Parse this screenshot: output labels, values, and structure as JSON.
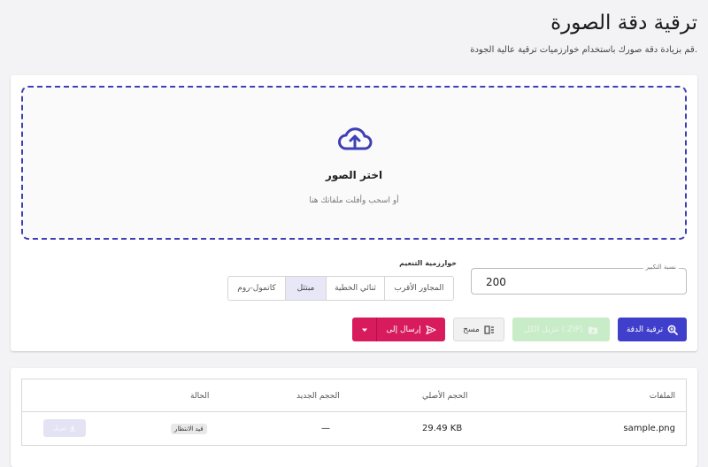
{
  "header": {
    "title": "ترقية دقة الصورة",
    "subtitle": "قم بزيادة دقة صورك باستخدام خوارزميات ترقية عالية الجودة."
  },
  "dropzone": {
    "icon": "cloud-upload-icon",
    "title": "اختر الصور",
    "subtitle": "أو اسحب وأفلت ملفاتك هنا"
  },
  "scale_field": {
    "label": "نسبة التكبير",
    "value": "200"
  },
  "algorithm": {
    "label": "خوارزمية التنعيم",
    "options": [
      "المجاور الأقرب",
      "ثنائي الخطية",
      "مبتثل",
      "كاتمول-روم"
    ],
    "selected": "مبتثل"
  },
  "actions": {
    "upscale_label": "ترقية الدقة",
    "zip_label": "تنزيل الكل (.ZIP)",
    "clear_label": "مسح",
    "send_label": "إرسال إلى"
  },
  "colors": {
    "primary": "#3f3fcc",
    "send": "#d81b5c",
    "zip_disabled": "#c8ecc8"
  },
  "table": {
    "headers": {
      "file": "الملفات",
      "original_size": "الحجم الأصلي",
      "new_size": "الحجم الجديد",
      "status": "الحالة"
    },
    "rows": [
      {
        "file": "sample.png",
        "original_size": "29.49 KB",
        "new_size": "—",
        "status": "قيد الانتظار",
        "download_label": "تنزيل"
      }
    ]
  }
}
